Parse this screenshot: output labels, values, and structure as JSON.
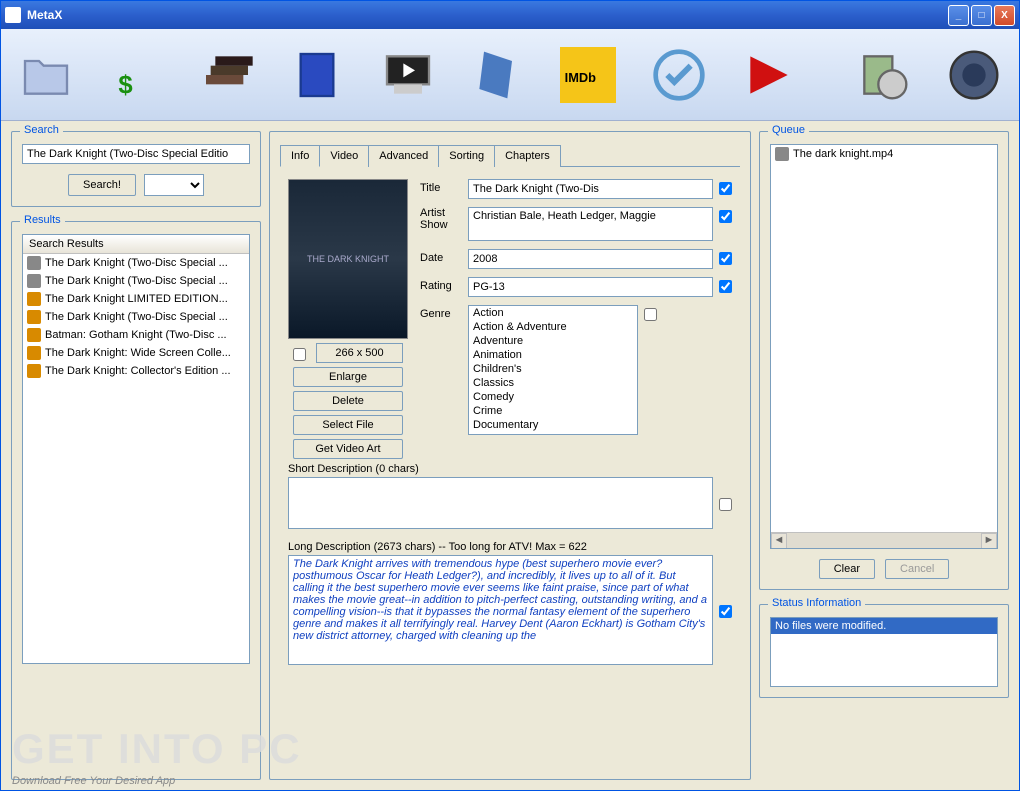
{
  "app": {
    "title": "MetaX"
  },
  "search": {
    "title": "Search",
    "value": "The Dark Knight (Two-Disc Special Editio",
    "button": "Search!"
  },
  "results": {
    "title": "Results",
    "header": "Search Results",
    "items": [
      "The Dark Knight (Two-Disc Special ...",
      "The Dark Knight (Two-Disc Special ...",
      "The Dark Knight LIMITED EDITION...",
      "The Dark Knight (Two-Disc Special ...",
      "Batman: Gotham Knight (Two-Disc ...",
      "The Dark Knight: Wide Screen Colle...",
      "The Dark Knight: Collector's Edition ..."
    ]
  },
  "tabs": [
    "Info",
    "Video",
    "Advanced",
    "Sorting",
    "Chapters"
  ],
  "info": {
    "poster_dim": "266 x 500",
    "btn_enlarge": "Enlarge",
    "btn_delete": "Delete",
    "btn_select": "Select File",
    "btn_getart": "Get Video Art",
    "title_label": "Title",
    "title_value": "The Dark Knight (Two-Dis",
    "artist_label": "Artist",
    "show_label": "Show",
    "artist_value": "Christian Bale, Heath Ledger, Maggie",
    "date_label": "Date",
    "date_value": "2008",
    "rating_label": "Rating",
    "rating_value": "PG-13",
    "genre_label": "Genre",
    "genres": [
      "Action",
      "Action & Adventure",
      "Adventure",
      "Animation",
      "Children's",
      "Classics",
      "Comedy",
      "Crime",
      "Documentary"
    ],
    "short_label": "Short Description (0 chars)",
    "short_value": "",
    "long_label": "Long Description (2673 chars)  -- Too long for ATV! Max = 622",
    "long_value": "The Dark Knight arrives with tremendous hype (best superhero movie ever? posthumous Oscar for Heath Ledger?), and incredibly, it lives up to all of it. But calling it the best superhero movie ever seems like faint praise, since part of what makes the movie great--in addition to pitch-perfect casting, outstanding writing, and a compelling vision--is that it bypasses the normal fantasy element of the superhero genre and makes it all terrifyingly real. Harvey Dent (Aaron Eckhart) is Gotham City's new district attorney, charged with cleaning up the"
  },
  "queue": {
    "title": "Queue",
    "items": [
      "The dark knight.mp4"
    ],
    "clear": "Clear",
    "cancel": "Cancel"
  },
  "status": {
    "title": "Status Information",
    "line": "No files were modified."
  },
  "watermark": {
    "big": "GET INTO PC",
    "sub": "Download Free Your Desired App"
  }
}
